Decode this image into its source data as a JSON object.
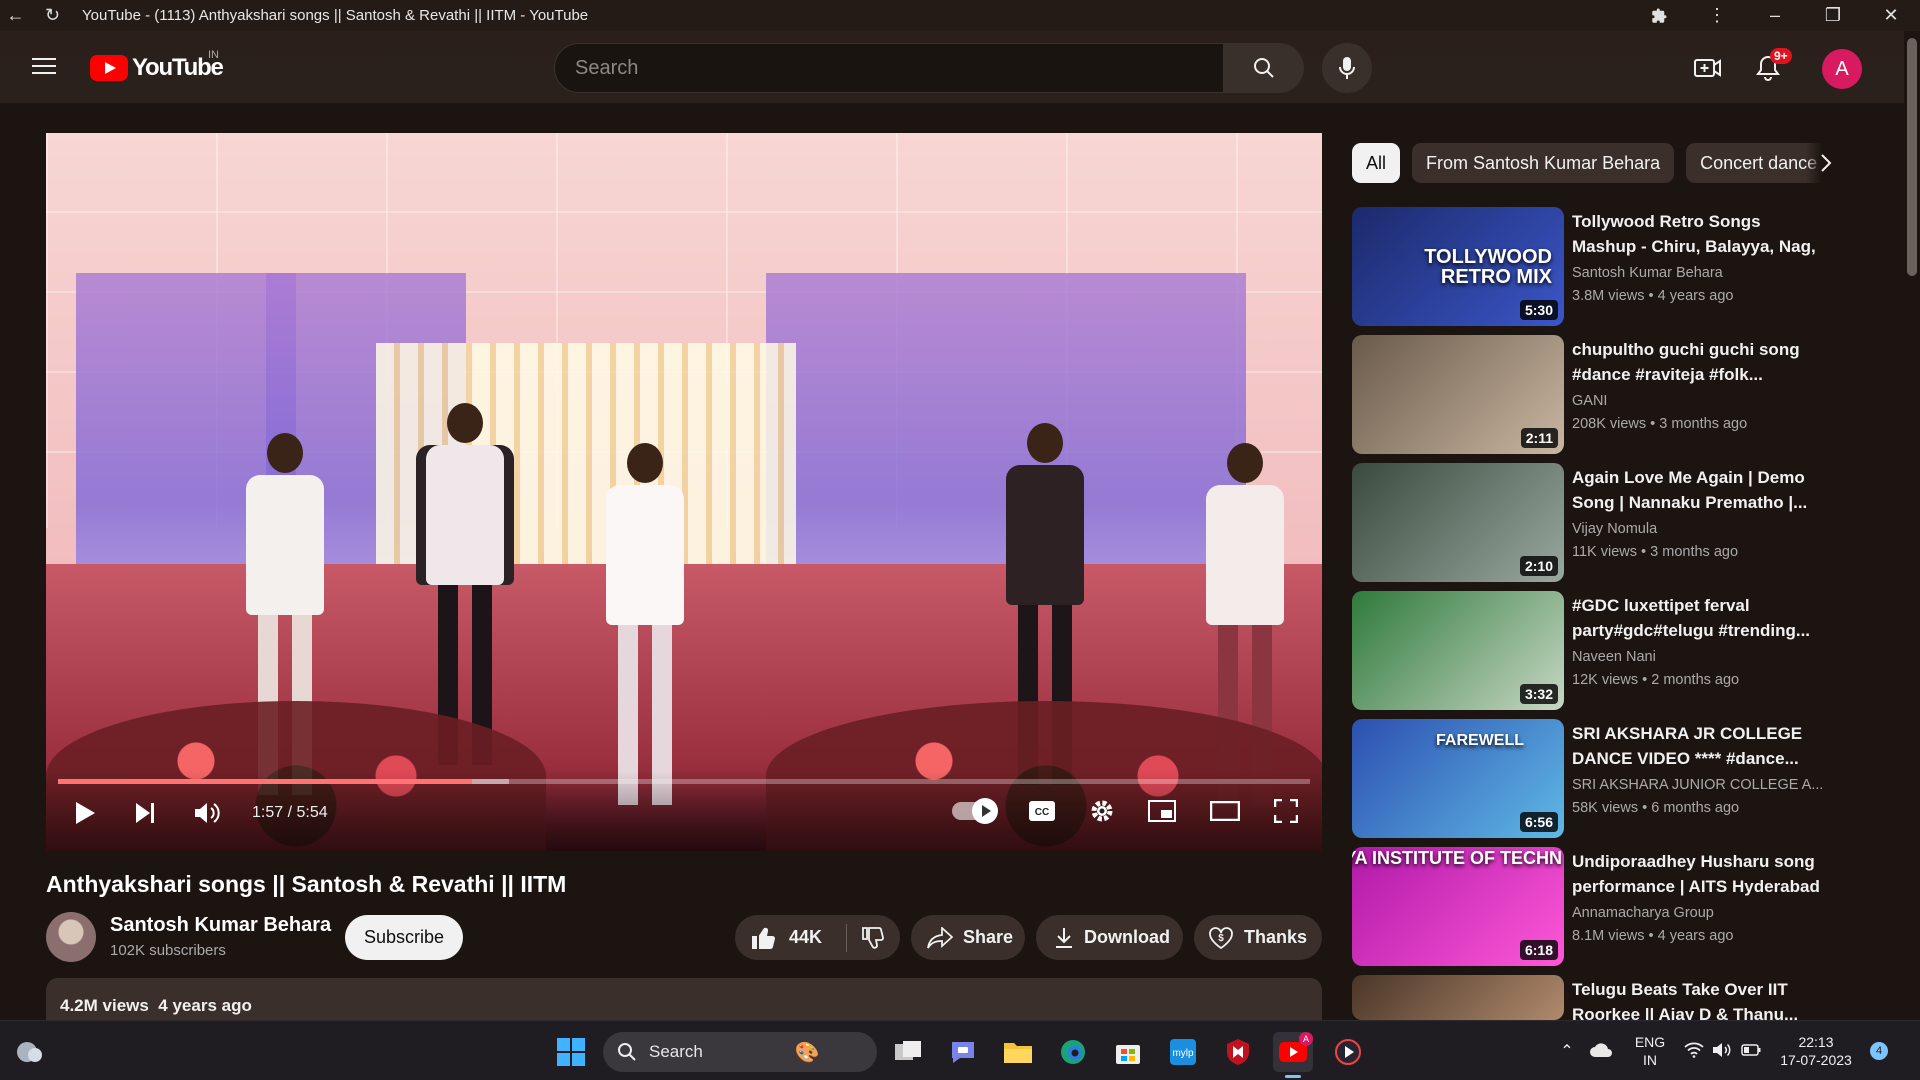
{
  "browser": {
    "title": "YouTube - (1113) Anthyakshari songs || Santosh & Revathi || IITM - YouTube"
  },
  "header": {
    "logo_text": "YouTube",
    "country_code": "IN",
    "search_placeholder": "Search",
    "notification_count": "9+",
    "avatar_letter": "A"
  },
  "player": {
    "time": "1:57 / 5:54",
    "progress_fraction": 0.331,
    "buffered_fraction": 0.33
  },
  "video": {
    "title": "Anthyakshari songs || Santosh & Revathi || IITM",
    "channel": "Santosh Kumar Behara",
    "subscribers": "102K subscribers",
    "subscribe_label": "Subscribe",
    "likes": "44K",
    "share_label": "Share",
    "download_label": "Download",
    "thanks_label": "Thanks",
    "views": "4.2M views",
    "age": "4 years ago"
  },
  "chips": [
    "All",
    "From Santosh Kumar Behara",
    "Concert dance"
  ],
  "recommendations": [
    {
      "title": "Tollywood Retro Songs Mashup - Chiru, Balayya, Nag, Venky |...",
      "channel": "Santosh Kumar Behara",
      "views": "3.8M views",
      "age": "4 years ago",
      "duration": "5:30",
      "thumb_text": "TOLLYWOOD\nRETRO MIX",
      "colors": [
        "#1b2a6b",
        "#3b56c8"
      ]
    },
    {
      "title": "chupultho guchi guchi song #dance #raviteja #folk...",
      "channel": "GANI",
      "views": "208K views",
      "age": "3 months ago",
      "duration": "2:11",
      "thumb_text": "",
      "colors": [
        "#6a5a4a",
        "#c9b7a2"
      ]
    },
    {
      "title": "Again Love Me Again | Demo Song | Nannaku Prematho |...",
      "channel": "Vijay Nomula",
      "views": "11K views",
      "age": "3 months ago",
      "duration": "2:10",
      "thumb_text": "",
      "colors": [
        "#3a4a3e",
        "#9aa9a0"
      ]
    },
    {
      "title": "#GDC luxettipet ferval party#gdc#telugu #trending...",
      "channel": "Naveen Nani",
      "views": "12K views",
      "age": "2 months ago",
      "duration": "3:32",
      "thumb_text": "",
      "colors": [
        "#2f7a3b",
        "#c7d7c4"
      ]
    },
    {
      "title": "SRI AKSHARA JR COLLEGE DANCE VIDEO **** #dance...",
      "channel": "SRI AKSHARA JUNIOR COLLEGE A...",
      "views": "58K views",
      "age": "6 months ago",
      "duration": "6:56",
      "thumb_text": "FAREWELL",
      "colors": [
        "#2c4fb0",
        "#5fb9e6"
      ]
    },
    {
      "title": "Undiporaadhey Husharu song performance | AITS Hyderabad",
      "channel": "Annamacharya Group",
      "views": "8.1M views",
      "age": "4 years ago",
      "duration": "6:18",
      "thumb_text": "RYA INSTITUTE OF TECHN",
      "colors": [
        "#b019a8",
        "#ff58d8"
      ]
    },
    {
      "title": "Telugu Beats Take Over IIT Roorkee || Ajay D & Thanu...",
      "channel": "",
      "views": "",
      "age": "",
      "duration": "",
      "thumb_text": "",
      "colors": [
        "#4a3628",
        "#b08a6c"
      ]
    }
  ],
  "taskbar": {
    "search_label": "Search",
    "lang": "ENG",
    "region": "IN",
    "time": "22:13",
    "date": "17-07-2023",
    "notif_count": "4"
  }
}
